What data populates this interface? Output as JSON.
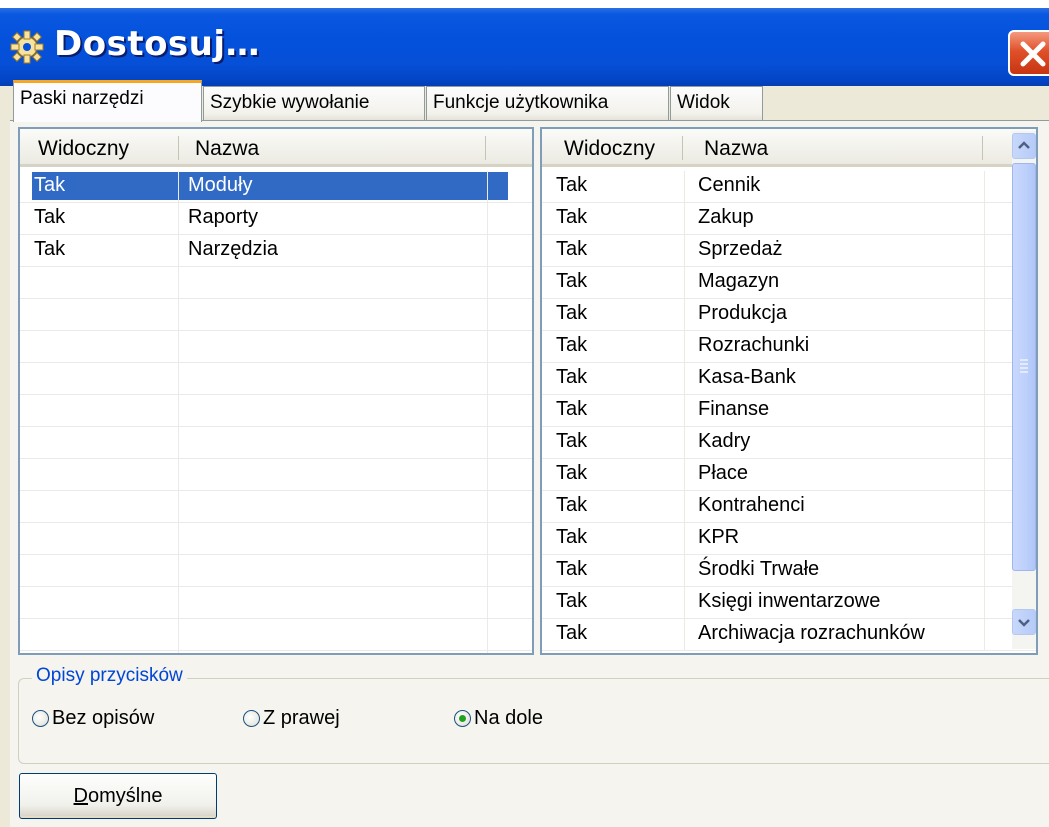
{
  "window": {
    "title": "Dostosuj…",
    "icon": "gear-icon",
    "close_icon": "close-icon"
  },
  "tabs": [
    {
      "label": "Paski narzędzi",
      "active": true
    },
    {
      "label": "Szybkie wywołanie",
      "active": false
    },
    {
      "label": "Funkcje użytkownika",
      "active": false
    },
    {
      "label": "Widok",
      "active": false
    }
  ],
  "left_grid": {
    "columns": [
      "Widoczny",
      "Nazwa"
    ],
    "rows": [
      {
        "visible": "Tak",
        "name": "Moduły",
        "selected": true
      },
      {
        "visible": "Tak",
        "name": "Raporty",
        "selected": false
      },
      {
        "visible": "Tak",
        "name": "Narzędzia",
        "selected": false
      }
    ]
  },
  "right_grid": {
    "columns": [
      "Widoczny",
      "Nazwa"
    ],
    "rows": [
      {
        "visible": "Tak",
        "name": "Cennik"
      },
      {
        "visible": "Tak",
        "name": "Zakup"
      },
      {
        "visible": "Tak",
        "name": "Sprzedaż"
      },
      {
        "visible": "Tak",
        "name": "Magazyn"
      },
      {
        "visible": "Tak",
        "name": "Produkcja"
      },
      {
        "visible": "Tak",
        "name": "Rozrachunki"
      },
      {
        "visible": "Tak",
        "name": "Kasa-Bank"
      },
      {
        "visible": "Tak",
        "name": "Finanse"
      },
      {
        "visible": "Tak",
        "name": "Kadry"
      },
      {
        "visible": "Tak",
        "name": "Płace"
      },
      {
        "visible": "Tak",
        "name": "Kontrahenci"
      },
      {
        "visible": "Tak",
        "name": "KPR"
      },
      {
        "visible": "Tak",
        "name": "Środki Trwałe"
      },
      {
        "visible": "Tak",
        "name": "Księgi inwentarzowe"
      },
      {
        "visible": "Tak",
        "name": "Archiwacja rozrachunków"
      }
    ]
  },
  "button_descriptions": {
    "legend": "Opisy przycisków",
    "options": [
      {
        "label": "Bez opisów",
        "checked": false
      },
      {
        "label": "Z prawej",
        "checked": false
      },
      {
        "label": "Na dole",
        "checked": true
      }
    ]
  },
  "default_button": {
    "label_accel": "D",
    "label_rest": "omyślne"
  },
  "colors": {
    "titlebar": "#0451dc",
    "selection": "#316ac5",
    "tab_highlight": "#f5a623",
    "legend_text": "#0046d5"
  }
}
